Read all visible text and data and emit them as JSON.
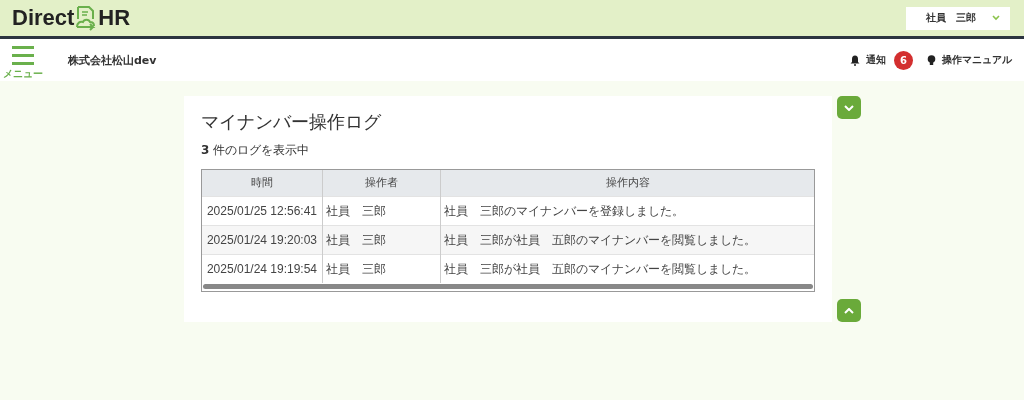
{
  "header": {
    "logo_left": "Direct",
    "logo_right": "HR",
    "user_menu": "社員　三郎"
  },
  "toolbar": {
    "menu_label": "メニュー",
    "company": "株式会社松山dev",
    "notifications": {
      "label": "通知",
      "count": "6"
    },
    "manual": "操作マニュアル"
  },
  "page": {
    "title": "マイナンバー操作ログ",
    "summary": "**3** 件のログを表示中"
  },
  "table": {
    "columns": [
      "時間",
      "操作者",
      "操作内容"
    ],
    "rows": [
      {
        "cells": [
          "2025/01/25 12:56:41",
          "社員　三郎",
          "社員　三郎のマイナンバーを登録しました。"
        ]
      },
      {
        "cells": [
          "2025/01/24 19:20:03",
          "社員　三郎",
          "社員　三郎が社員　五郎のマイナンバーを閲覧しました。"
        ]
      },
      {
        "cells": [
          "2025/01/24 19:19:54",
          "社員　三郎",
          "社員　三郎が社員　五郎のマイナンバーを閲覧しました。"
        ]
      }
    ]
  }
}
